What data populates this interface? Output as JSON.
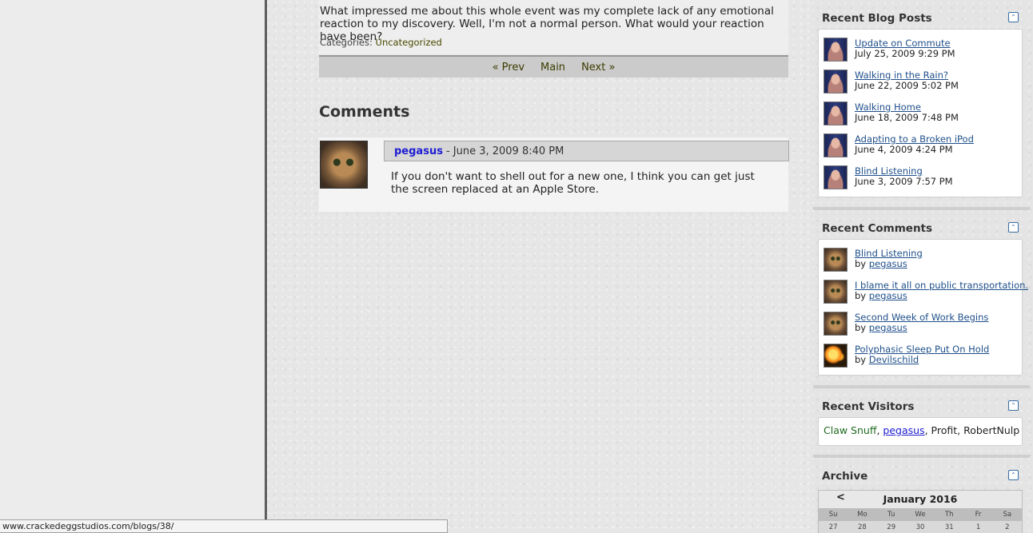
{
  "post": {
    "tail_text": "What impressed me about this whole event was my complete lack of any emotional reaction to my discovery. Well, I'm not a normal person. What would your reaction have been?",
    "categories_label": "Categories:",
    "category": "Uncategorized"
  },
  "pager": {
    "prev": "« Prev",
    "main": "Main",
    "next": "Next »"
  },
  "comments": {
    "heading": "Comments",
    "items": [
      {
        "author": "pegasus",
        "meta": "- June 3, 2009 8:40 PM",
        "body": "If you don't want to shell out for a new one, I think you can get just the screen replaced at an Apple Store."
      }
    ]
  },
  "sidebar": {
    "recent_posts": {
      "title": "Recent Blog Posts",
      "items": [
        {
          "title": "Update on Commute",
          "date": "July 25, 2009 9:29 PM"
        },
        {
          "title": "Walking in the Rain?",
          "date": "June 22, 2009 5:02 PM"
        },
        {
          "title": "Walking Home",
          "date": "June 18, 2009 7:48 PM"
        },
        {
          "title": "Adapting to a Broken iPod",
          "date": "June 4, 2009 4:24 PM"
        },
        {
          "title": "Blind Listening",
          "date": "June 3, 2009 7:57 PM"
        }
      ]
    },
    "recent_comments": {
      "title": "Recent Comments",
      "by_label": "by",
      "items": [
        {
          "title": "Blind Listening",
          "author": "pegasus"
        },
        {
          "title": "I blame it all on public transportation.",
          "author": "pegasus"
        },
        {
          "title": "Second Week of Work Begins",
          "author": "pegasus"
        },
        {
          "title": "Polyphasic Sleep Put On Hold",
          "author": "Devilschild"
        }
      ]
    },
    "recent_visitors": {
      "title": "Recent Visitors",
      "visitors": [
        "Claw Snuff",
        "pegasus",
        "Profit",
        "RobertNulp"
      ],
      "separator": ", "
    },
    "archive": {
      "title": "Archive",
      "prev": "<",
      "month": "January 2016",
      "weekdays": [
        "Su",
        "Mo",
        "Tu",
        "We",
        "Th",
        "Fr",
        "Sa"
      ],
      "first_row": [
        "27",
        "28",
        "29",
        "30",
        "31",
        "1",
        "2"
      ]
    },
    "collapse_glyph": "⌃"
  },
  "statusbar": {
    "url": "www.crackedeggstudios.com/blogs/38/"
  }
}
